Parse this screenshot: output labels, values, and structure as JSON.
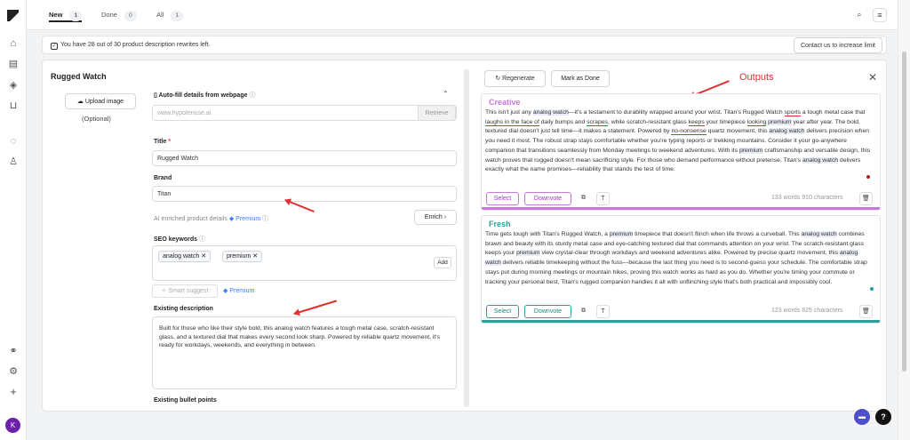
{
  "tabs": [
    {
      "label": "New",
      "count": "1"
    },
    {
      "label": "Done",
      "count": "0"
    },
    {
      "label": "All",
      "count": "1"
    }
  ],
  "quota": {
    "message": "You have 28 out of 30 product description rewrites left.",
    "contact_label": "Contact us to increase limit"
  },
  "product": {
    "title": "Rugged Watch",
    "upload_label": "Upload image",
    "optional_label": "(Optional)"
  },
  "form": {
    "autofill_label": "Auto-fill details from webpage",
    "url_placeholder": "www.hypotenuse.ai",
    "retrieve_label": "Retrieve",
    "title_label": "Title",
    "title_value": "Rugged Watch",
    "brand_label": "Brand",
    "brand_value": "Titan",
    "ai_enriched_label": "AI enriched product details",
    "premium_label": "Premium",
    "enrich_label": "Enrich",
    "seo_label": "SEO keywords",
    "keywords": [
      "analog watch",
      "premium"
    ],
    "add_label": "Add",
    "smart_suggest_label": "Smart suggest",
    "existing_desc_label": "Existing description",
    "existing_desc": "Built for those who like their style bold, this analog watch features a tough metal case, scratch-resistant glass, and a textured dial that makes every second look sharp. Powered by reliable quartz movement, it's ready for workdays, weekends, and everything in between.",
    "bullets_label": "Existing bullet points"
  },
  "results": {
    "regenerate_label": "Regenerate",
    "mark_done_label": "Mark as Done",
    "annotation": "Outputs",
    "outputs": [
      {
        "heading": "Creative",
        "color": "#c678dd",
        "text": "This isn't just any analog watch—it's a testament to durability wrapped around your wrist. Titan's Rugged Watch sports a tough metal case that laughs in the face of daily bumps and scrapes, while scratch-resistant glass keeps your timepiece looking premium year after year. The bold, textured dial doesn't just tell time—it makes a statement. Powered by no-nonsense quartz movement, this analog watch delivers precision when you need it most. The robust strap stays comfortable whether you're typing reports or trekking mountains. Consider it your go-anywhere companion that transitions seamlessly from Monday meetings to weekend adventures. With its premium craftsmanship and versatile design, this watch proves that rugged doesn't mean sacrificing style. For those who demand performance without pretense, Titan's analog watch delivers exactly what the name promises—reliability that stands the test of time.",
        "select_label": "Select",
        "downvote_label": "Downvote",
        "count_label": "133 words  910 characters"
      },
      {
        "heading": "Fresh",
        "color": "#2aa198",
        "text": "Time gets tough with Titan's Rugged Watch, a premium timepiece that doesn't flinch when life throws a curveball. This analog watch combines brawn and beauty with its sturdy metal case and eye-catching textured dial that commands attention on your wrist. The scratch-resistant glass keeps your premium view crystal-clear through workdays and weekend adventures alike. Powered by precise quartz movement, this analog watch delivers reliable timekeeping without the fuss—because the last thing you need is to second-guess your schedule. The comfortable strap stays put during morning meetings or mountain hikes, proving this watch works as hard as you do. Whether you're timing your commute or tracking your personal best, Titan's rugged companion handles it all with unflinching style that's both practical and impossibly cool.",
        "select_label": "Select",
        "downvote_label": "Downvote",
        "count_label": "123 words  825 characters"
      }
    ]
  },
  "user": {
    "initial": "K"
  }
}
